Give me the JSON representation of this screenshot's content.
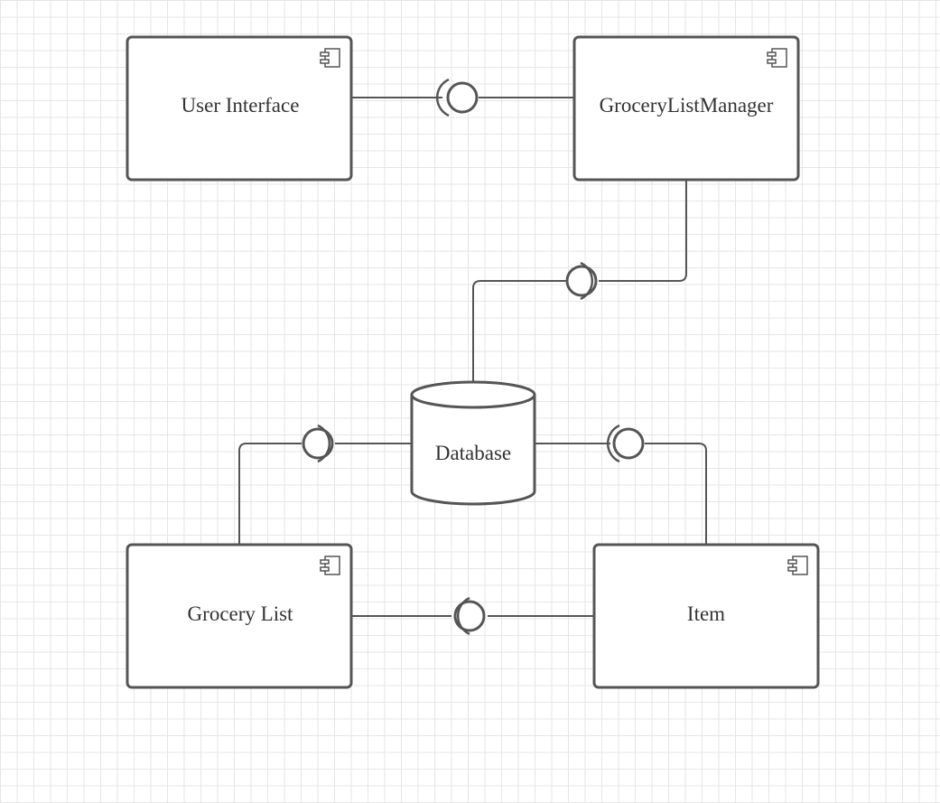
{
  "diagram": {
    "components": {
      "user_interface": "User Interface",
      "grocery_list_manager": "GroceryListManager",
      "grocery_list": "Grocery List",
      "item": "Item"
    },
    "database": "Database"
  },
  "colors": {
    "stroke": "#555555",
    "text": "#333333",
    "grid": "#e6e6e6",
    "background": "#ffffff"
  },
  "icons": {
    "component": "uml-component-icon",
    "interface": "lollipop-interface",
    "datastore": "database-cylinder"
  }
}
